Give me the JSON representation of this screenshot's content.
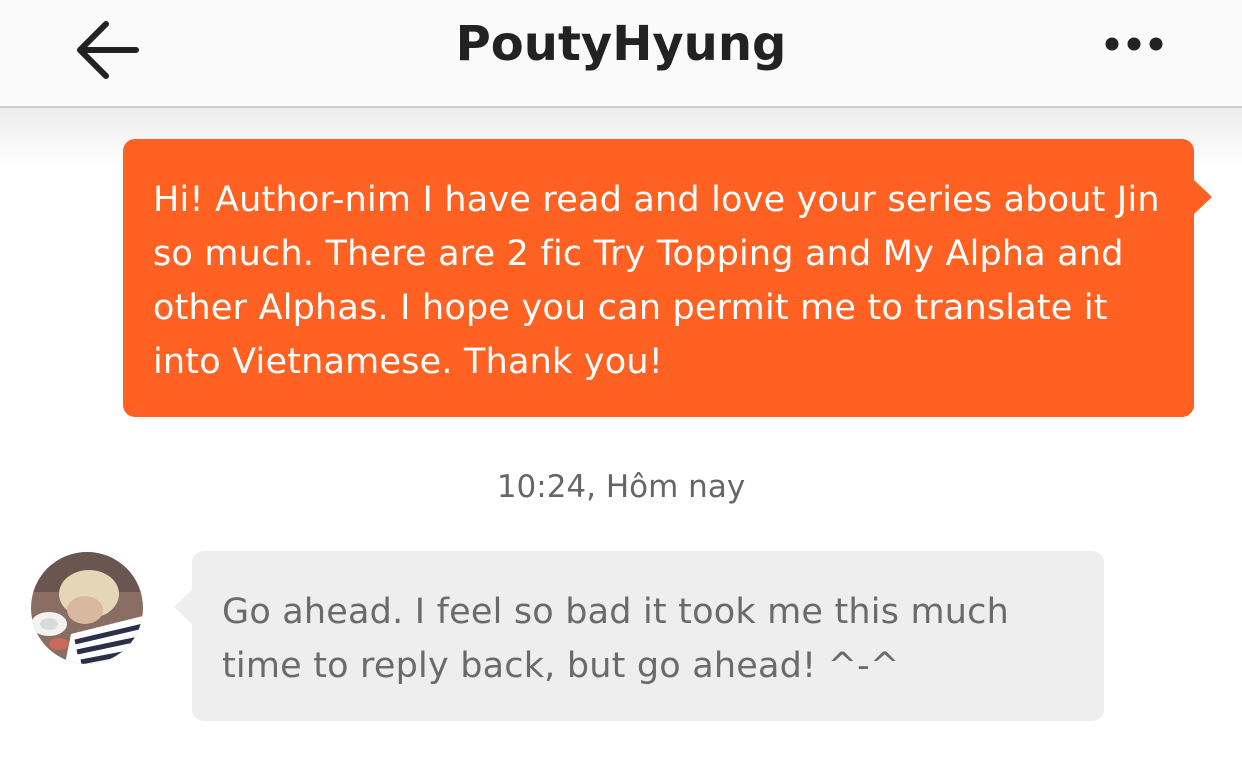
{
  "header": {
    "title": "PoutyHyung",
    "back_icon": "arrow-left-icon",
    "more_icon": "more-horizontal-icon"
  },
  "messages": [
    {
      "direction": "outgoing",
      "text": "Hi! Author-nim I have read and love your series about Jin so much. There are 2 fic Try Topping and My Alpha and other Alphas. I hope you can permit me to translate it into Vietnamese. Thank you!"
    },
    {
      "direction": "incoming",
      "text": "Go ahead. I feel so bad it took me this much time to reply back, but go ahead! ^-^"
    }
  ],
  "timestamp": "10:24, Hôm nay",
  "colors": {
    "outgoing_bubble": "#ff6122",
    "incoming_bubble": "#eeeeee"
  }
}
